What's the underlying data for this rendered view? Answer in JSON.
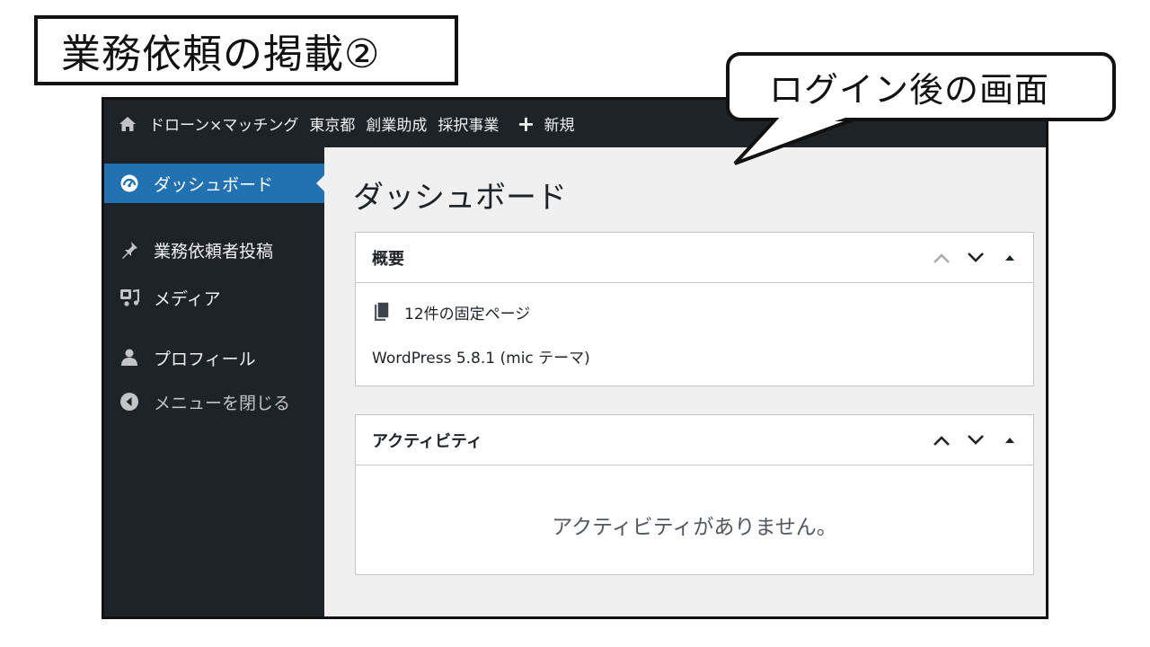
{
  "slide": {
    "title": "業務依頼の掲載②",
    "callout": "ログイン後の画面"
  },
  "admin_bar": {
    "site_name": "ドローン×マッチング",
    "items": [
      "東京都",
      "創業助成",
      "採択事業"
    ],
    "new_label": "新規"
  },
  "sidebar": {
    "items": [
      {
        "label": "ダッシュボード",
        "icon": "dashboard-icon",
        "current": true
      },
      {
        "label": "業務依頼者投稿",
        "icon": "pin-icon"
      },
      {
        "label": "メディア",
        "icon": "media-icon"
      },
      {
        "label": "プロフィール",
        "icon": "user-icon"
      },
      {
        "label": "メニューを閉じる",
        "icon": "collapse-icon"
      }
    ]
  },
  "main": {
    "page_title": "ダッシュボード",
    "at_a_glance": {
      "title": "概要",
      "pages_count": "12件の固定ページ",
      "wp_version": "WordPress 5.8.1 (mic テーマ)"
    },
    "activity": {
      "title": "アクティビティ",
      "empty_message": "アクティビティがありません。"
    }
  },
  "colors": {
    "admin_dark": "#1d2327",
    "accent_blue": "#2271b1",
    "content_bg": "#f0f0f1"
  }
}
